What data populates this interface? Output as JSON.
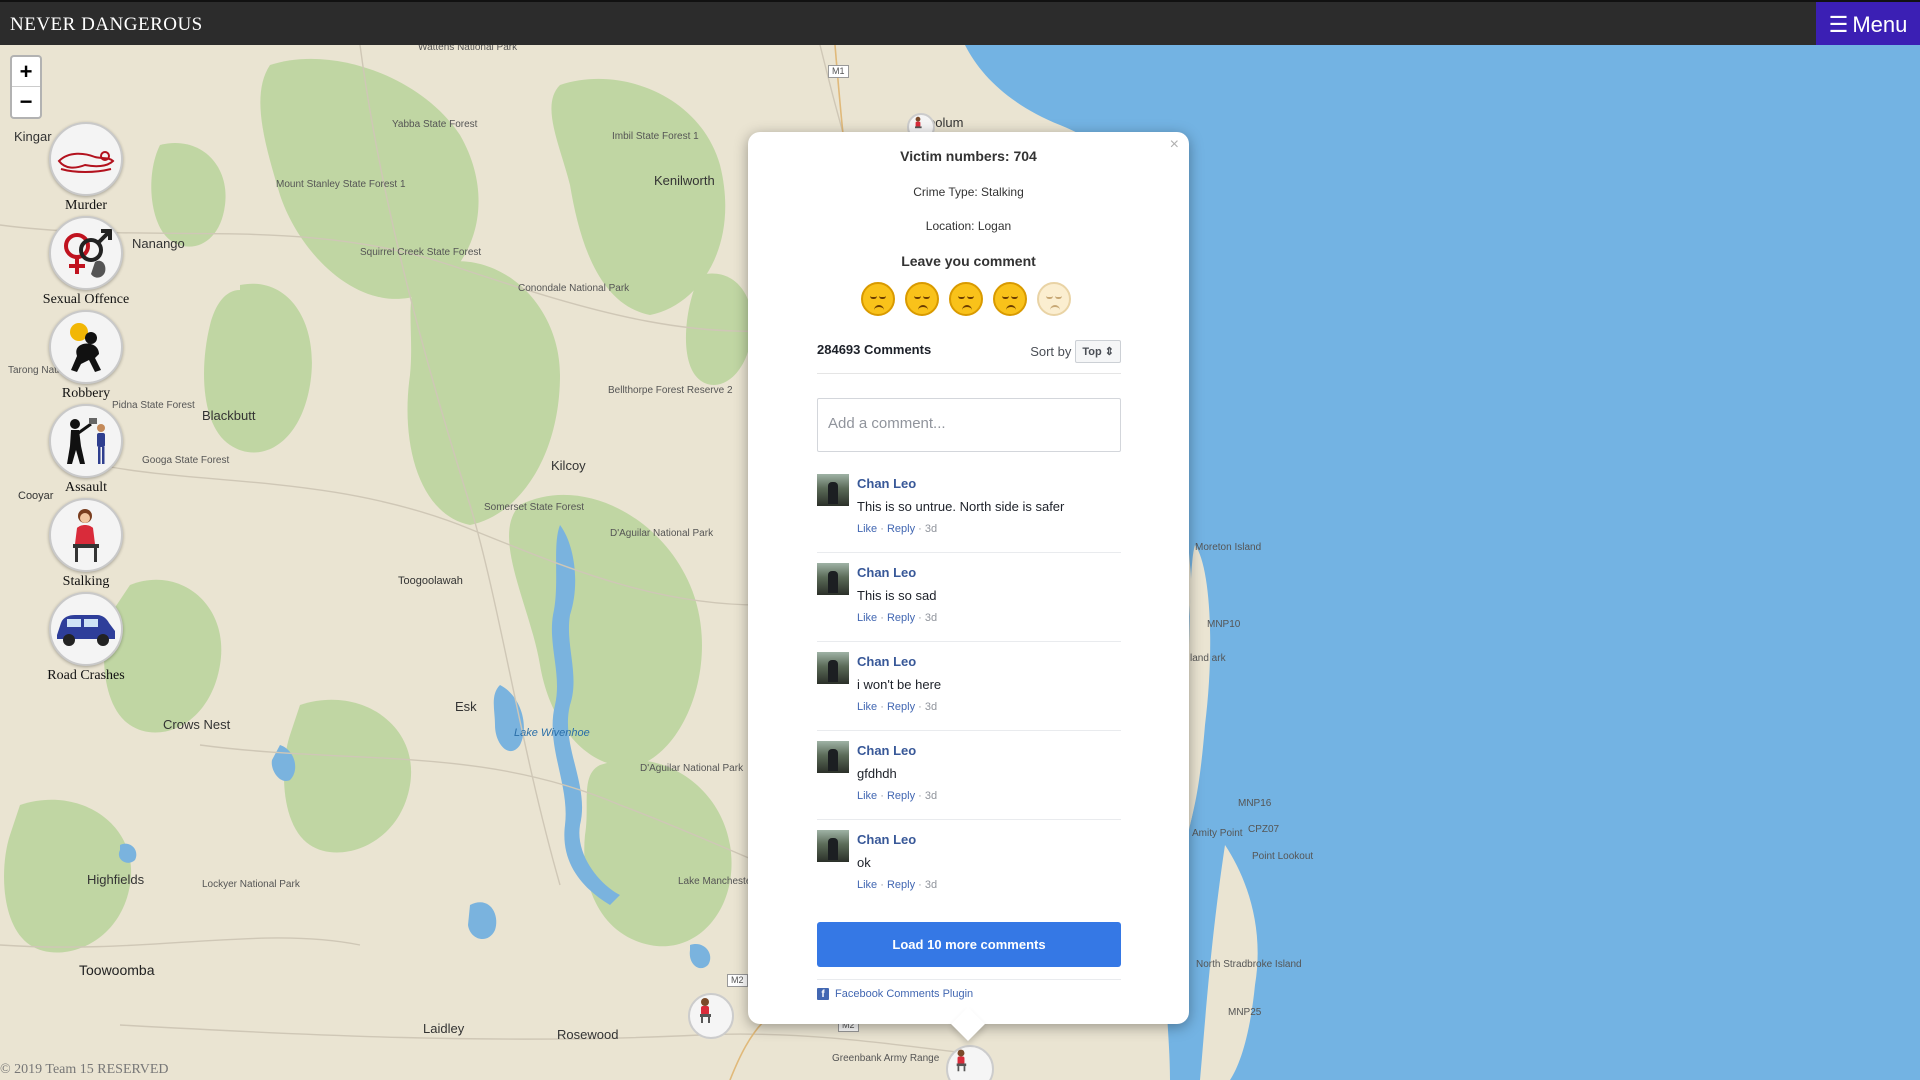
{
  "header": {
    "brand": "NEVER DANGEROUS",
    "menu_label": "Menu",
    "menu_icon": "hamburger-icon"
  },
  "zoom": {
    "in": "+",
    "out": "−"
  },
  "crime_types": [
    {
      "label": "Murder",
      "icon": "murder-icon"
    },
    {
      "label": "Sexual Offence",
      "icon": "sexual-offence-icon"
    },
    {
      "label": "Robbery",
      "icon": "robbery-icon"
    },
    {
      "label": "Assault",
      "icon": "assault-icon"
    },
    {
      "label": "Stalking",
      "icon": "stalking-icon"
    },
    {
      "label": "Road Crashes",
      "icon": "road-crashes-icon"
    }
  ],
  "map_labels": {
    "kingaroy": "Kingar",
    "nanango": "Nanango",
    "blackbutt": "Blackbutt",
    "kilcoy": "Kilcoy",
    "kenilworth": "Kenilworth",
    "toogoolawah": "Toogoolawah",
    "esk": "Esk",
    "crows_nest": "Crows Nest",
    "highfields": "Highfields",
    "toowoomba": "Toowoomba",
    "laidley": "Laidley",
    "rosewood": "Rosewood",
    "cooyar": "Cooyar",
    "pooloom": "polum",
    "moreton_island": "Moreton Island",
    "amity_point": "Amity Point",
    "point_lookout": "Point Lookout",
    "north_stradbroke": "North Stradbroke Island",
    "lake_wivenhoe": "Lake Wivenhoe",
    "wattens": "Wattens National Park",
    "yabba": "Yabba State Forest",
    "imbil": "Imbil State Forest 1",
    "mount_stanley": "Mount Stanley State Forest 1",
    "squirrel_creek": "Squirrel Creek State Forest",
    "conondale": "Conondale National Park",
    "bellthorpe": "Bellthorpe Forest Reserve 2",
    "pidna": "Pidna State Forest",
    "googa": "Googa State Forest",
    "tarong": "Tarong National Park",
    "somerset": "Somerset State Forest",
    "daguilar1": "D'Aguilar National Park",
    "daguilar2": "D'Aguilar National Park",
    "lockyer": "Lockyer National Park",
    "lake_manchester": "Lake Manchester Reservoir Seqwater",
    "greenbank": "Greenbank Army Range",
    "mnp10": "MNP10",
    "mnp16": "MNP16",
    "mnp25": "MNP25",
    "cpz07": "CPZ07",
    "m1": "M1",
    "m2a": "M2",
    "m2b": "M2",
    "island_park": "land ark"
  },
  "popup": {
    "close": "×",
    "victims": "Victim numbers: 704",
    "crime_type": "Crime Type: Stalking",
    "location": "Location: Logan",
    "leave_comment": "Leave you comment",
    "ratings": [
      {
        "icon": "sad-face-icon",
        "active": true
      },
      {
        "icon": "sad-face-icon",
        "active": true
      },
      {
        "icon": "sad-face-icon",
        "active": true
      },
      {
        "icon": "sad-face-icon",
        "active": true
      },
      {
        "icon": "sad-face-icon",
        "active": false
      }
    ]
  },
  "comments": {
    "count_label": "284693 Comments",
    "sort_label": "Sort by",
    "sort_value": "Top",
    "input_placeholder": "Add a comment...",
    "items": [
      {
        "name": "Chan Leo",
        "text": "This is so untrue. North side is safer",
        "like": "Like",
        "reply": "Reply",
        "time": "3d"
      },
      {
        "name": "Chan Leo",
        "text": "This is so sad",
        "like": "Like",
        "reply": "Reply",
        "time": "3d"
      },
      {
        "name": "Chan Leo",
        "text": "i won't be here",
        "like": "Like",
        "reply": "Reply",
        "time": "3d"
      },
      {
        "name": "Chan Leo",
        "text": "gfdhdh",
        "like": "Like",
        "reply": "Reply",
        "time": "3d"
      },
      {
        "name": "Chan Leo",
        "text": "ok",
        "like": "Like",
        "reply": "Reply",
        "time": "3d"
      }
    ],
    "load_more": "Load 10 more comments",
    "plugin": "Facebook Comments Plugin"
  },
  "footer": {
    "copyright": "© 2019 Team 15 RESERVED"
  },
  "colors": {
    "topbar": "#2c2c2c",
    "menu": "#3b1fb4",
    "ocean": "#73b3e3",
    "fb_blue": "#3578e5"
  }
}
